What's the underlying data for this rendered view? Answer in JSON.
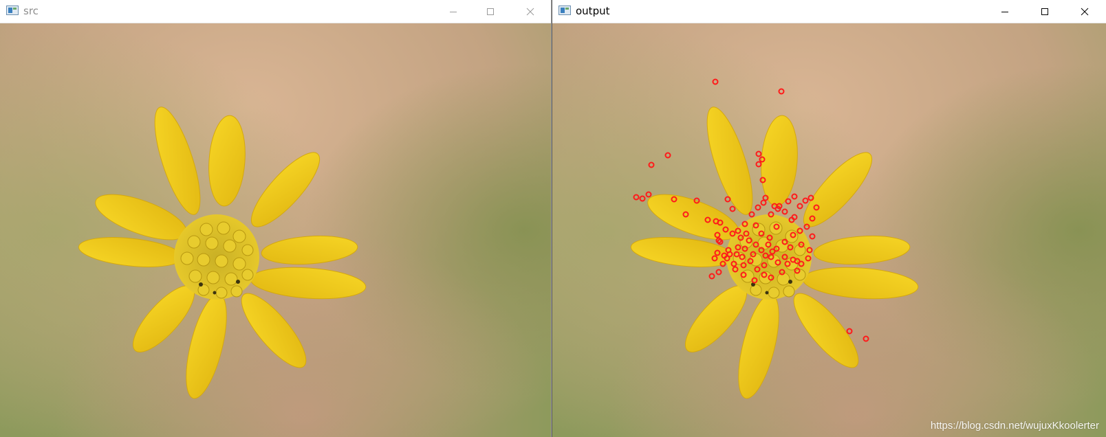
{
  "windows": {
    "src": {
      "title": "src"
    },
    "output": {
      "title": "output"
    }
  },
  "controls": {
    "minimize_icon": "minimize-icon",
    "maximize_icon": "maximize-icon",
    "close_icon": "close-icon"
  },
  "image": {
    "subject": "yellow flower",
    "petal_color": "#f0c61a",
    "background_colors": [
      "#c9a787",
      "#8f9c5a",
      "#d7b08e"
    ],
    "marker_color": "#ff1a1a"
  },
  "watermark": "https://blog.csdn.net/wujuxKkoolerter"
}
